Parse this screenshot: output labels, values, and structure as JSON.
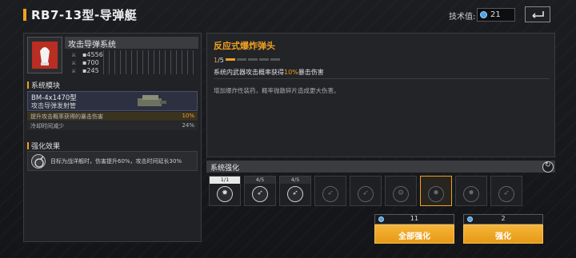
{
  "header": {
    "title": "RB7-13型-导弹艇",
    "tech_label": "技术值:",
    "tech_value": "21"
  },
  "weapon": {
    "name": "攻击导弹系统",
    "stats": [
      "4556",
      "700",
      "245"
    ]
  },
  "modules": {
    "section_title": "系统模块",
    "name": "BM-4x1470型",
    "sub": "攻击导弹发射管",
    "rows": [
      {
        "label": "提升攻击概率获得的暴击伤害",
        "value": "10%"
      },
      {
        "label": "冷却时间减少",
        "value": "24%"
      }
    ]
  },
  "enhance_effect": {
    "section_title": "强化效果",
    "text": "目标为战洋舰时，伤害提升60%，攻击时间延长30%"
  },
  "ability": {
    "title": "反应式爆炸弹头",
    "level": "1",
    "level_max": "/5",
    "pips_on": 1,
    "pips_total": 5,
    "desc_pre": "系统内武器攻击概率获得",
    "desc_hl": "10%",
    "desc_post": "暴击伤害",
    "detail": "增加爆炸性装药，概率抛散碎片造成更大伤害。"
  },
  "system_enhance": {
    "title": "系统强化",
    "slots": [
      {
        "count": "1/1",
        "icon": "bomb-icon"
      },
      {
        "count": "4/5",
        "icon": "missile-icon"
      },
      {
        "count": "4/5",
        "icon": "missile-icon"
      },
      {
        "count": "",
        "icon": "missile-icon"
      },
      {
        "count": "",
        "icon": "missile-icon"
      },
      {
        "count": "",
        "icon": "gear-icon"
      },
      {
        "count": "",
        "icon": "explosion-icon"
      },
      {
        "count": "",
        "icon": "explosion-icon"
      },
      {
        "count": "",
        "icon": "missile-icon"
      }
    ]
  },
  "actions": {
    "all_cost": "11",
    "all_label": "全部强化",
    "one_cost": "2",
    "one_label": "强化"
  },
  "colors": {
    "accent": "#f0a020",
    "tech_blue": "#4aa3e8"
  }
}
